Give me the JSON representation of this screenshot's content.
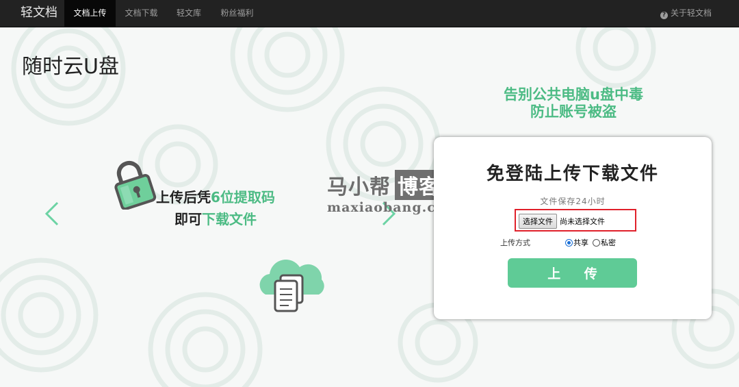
{
  "navbar": {
    "brand": "轻文档",
    "items": [
      {
        "label": "文档上传",
        "active": true
      },
      {
        "label": "文档下载",
        "active": false
      },
      {
        "label": "轻文库",
        "active": false
      },
      {
        "label": "粉丝福利",
        "active": false
      }
    ],
    "about": {
      "icon": "question-circle-icon",
      "label": "关于轻文档"
    }
  },
  "page_title": "随时云U盘",
  "slogan": {
    "line1": "告别公共电脑u盘中毒",
    "line2": "防止账号被盗"
  },
  "carousel": {
    "line1_prefix": "上传后凭",
    "line1_highlight": "6位提取码",
    "line2_prefix": "即可",
    "line2_highlight": "下载文件",
    "prev_icon": "chevron-left-icon",
    "next_icon": "chevron-right-icon"
  },
  "watermark": {
    "cn_left": "马小帮",
    "cn_box": "博客",
    "en": "maxiaobang.com"
  },
  "upload_card": {
    "title": "免登陆上传下载文件",
    "subtitle": "文件保存24小时",
    "file_button": "选择文件",
    "file_status": "尚未选择文件",
    "mode_label": "上传方式",
    "modes": [
      {
        "label": "共享",
        "selected": true
      },
      {
        "label": "私密",
        "selected": false
      }
    ],
    "upload_button": "上 传"
  },
  "colors": {
    "accent": "#4cbb84",
    "button": "#5fcb96",
    "navbar": "#222222",
    "highlight": "#e0202a"
  }
}
